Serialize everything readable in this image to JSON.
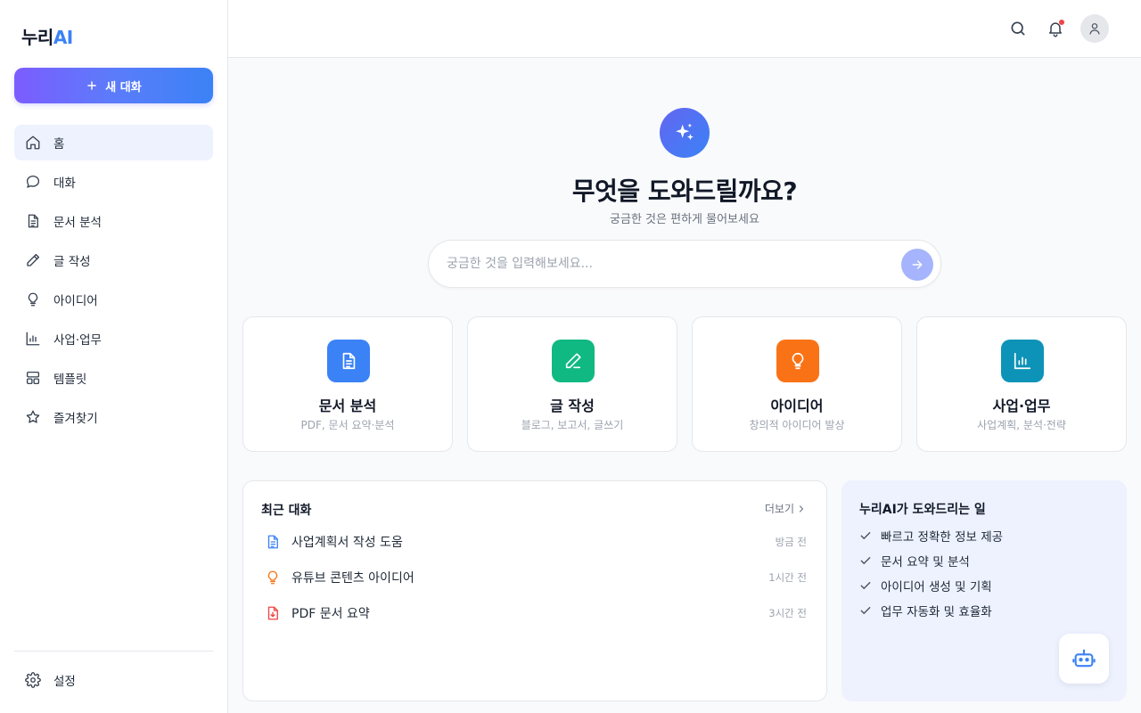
{
  "sidebar": {
    "logo_main": "누리",
    "logo_accent": "AI",
    "new_chat_label": "새 대화",
    "items": [
      {
        "label": "홈",
        "icon": "home-icon",
        "active": true
      },
      {
        "label": "대화",
        "icon": "chat-bubble-icon",
        "active": false
      },
      {
        "label": "문서 분석",
        "icon": "document-icon",
        "active": false
      },
      {
        "label": "글 작성",
        "icon": "pen-icon",
        "active": false
      },
      {
        "label": "아이디어",
        "icon": "lightbulb-icon",
        "active": false
      },
      {
        "label": "사업·업무",
        "icon": "bar-chart-icon",
        "active": false
      },
      {
        "label": "템플릿",
        "icon": "template-icon",
        "active": false
      },
      {
        "label": "즐겨찾기",
        "icon": "star-icon",
        "active": false
      }
    ],
    "settings_label": "설정"
  },
  "header": {
    "icons": [
      "search-icon",
      "bell-icon",
      "user-icon"
    ]
  },
  "hero": {
    "title": "무엇을 도와드릴까요?",
    "subtitle": "궁금한 것은 편하게 물어보세요",
    "placeholder": "궁금한 것을 입력해보세요..."
  },
  "cards": [
    {
      "title": "문서 분석",
      "desc": "PDF, 문서 요약·분석",
      "color": "#3b82f6",
      "icon": "document-icon"
    },
    {
      "title": "글 작성",
      "desc": "블로그, 보고서, 글쓰기",
      "color": "#10b981",
      "icon": "pen-icon"
    },
    {
      "title": "아이디어",
      "desc": "창의적 아이디어 발상",
      "color": "#f97316",
      "icon": "lightbulb-icon"
    },
    {
      "title": "사업·업무",
      "desc": "사업계획, 분석·전략",
      "color": "#0e93b8",
      "icon": "bar-chart-icon"
    }
  ],
  "recent": {
    "title": "최근 대화",
    "more_label": "더보기",
    "items": [
      {
        "label": "사업계획서 작성 도움",
        "time": "방금 전",
        "icon": "document-icon",
        "color": "#3b82f6"
      },
      {
        "label": "유튜브 콘텐츠 아이디어",
        "time": "1시간 전",
        "icon": "lightbulb-icon",
        "color": "#f97316"
      },
      {
        "label": "PDF 문서 요약",
        "time": "3시간 전",
        "icon": "pdf-file-icon",
        "color": "#ef4444"
      }
    ]
  },
  "help": {
    "title": "누리AI가 도와드리는 일",
    "items": [
      "빠르고 정확한 정보 제공",
      "문서 요약 및 분석",
      "아이디어 생성 및 기획",
      "업무 자동화 및 효율화"
    ]
  }
}
